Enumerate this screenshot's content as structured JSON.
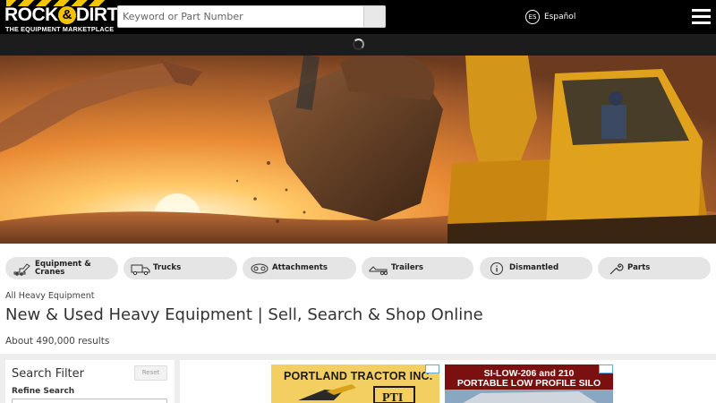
{
  "header": {
    "logo_text_left": "ROCK",
    "logo_amp": "&",
    "logo_text_right": "DIRT",
    "logo_tagline": "THE EQUIPMENT MARKETPLACE",
    "search_placeholder": "Keyword or Part Number",
    "search_icon": "search-icon",
    "lang_badge": "ES",
    "lang_label": "Español",
    "menu_icon": "hamburger-menu-icon"
  },
  "colors": {
    "header_bg": "#000000",
    "accent": "#f5c400",
    "tab_bg": "#e5e5e5"
  },
  "categories": [
    {
      "label_line1": "Equipment &",
      "label_line2": "Cranes",
      "icon": "excavator-icon"
    },
    {
      "label_line1": "Trucks",
      "label_line2": "",
      "icon": "truck-icon"
    },
    {
      "label_line1": "Attachments",
      "label_line2": "",
      "icon": "attachment-icon"
    },
    {
      "label_line1": "Trailers",
      "label_line2": "",
      "icon": "trailer-icon"
    },
    {
      "label_line1": "Dismantled",
      "label_line2": "",
      "icon": "info-icon"
    },
    {
      "label_line1": "Parts",
      "label_line2": "",
      "icon": "wrench-icon"
    }
  ],
  "page": {
    "breadcrumb": "All Heavy Equipment",
    "title": "New & Used Heavy Equipment | Sell, Search & Shop Online",
    "results": "About 490,000 results"
  },
  "filter": {
    "title": "Search Filter",
    "reset_label": "Reset",
    "refine_label": "Refine Search"
  },
  "ads": [
    {
      "line1": "PORTLAND TRACTOR INC.",
      "logo": "PTI"
    },
    {
      "line1": "SI-LOW-206 and 210",
      "line2": "PORTABLE LOW PROFILE SILO"
    }
  ]
}
